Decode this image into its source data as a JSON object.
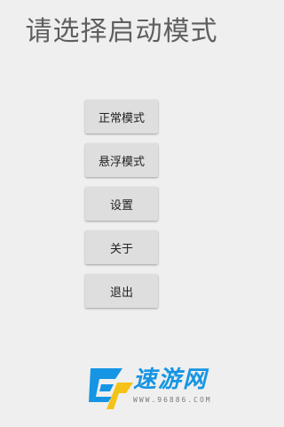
{
  "title": "请选择启动模式",
  "menu": {
    "items": [
      {
        "label": "正常模式"
      },
      {
        "label": "悬浮模式"
      },
      {
        "label": "设置"
      },
      {
        "label": "关于"
      },
      {
        "label": "退出"
      }
    ]
  },
  "watermark": {
    "name": "速游网",
    "url": "WWW.96886.COM"
  },
  "colors": {
    "background": "#efefef",
    "button": "#dedede",
    "title": "#5f5f5f",
    "watermark": "#1595e4"
  }
}
